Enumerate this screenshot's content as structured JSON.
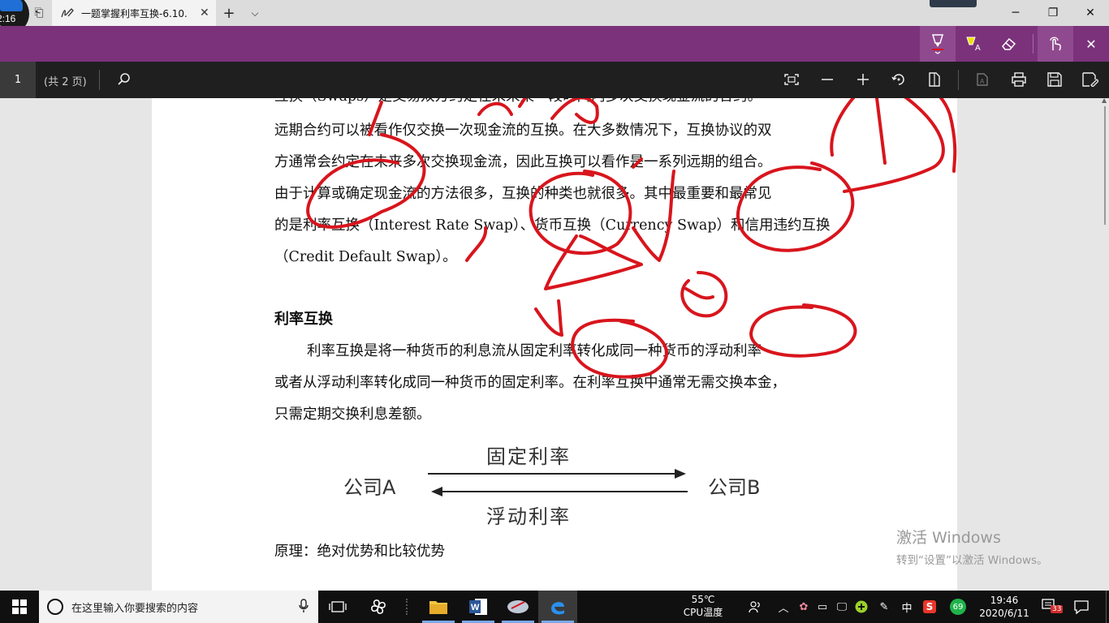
{
  "window": {
    "clock_badge": "2:16",
    "tab_title": "一题掌握利率互换-6.10.",
    "tab_close": "✕",
    "new_tab": "+",
    "tab_list": "⌵",
    "minimize": "─",
    "restore": "❐",
    "close": "✕"
  },
  "pdf_toolbar": {
    "page_number": "1",
    "page_total": "(共 2 页)"
  },
  "document": {
    "lines": [
      "互换（Swaps）是交易双方约定在未来某一段时间内多次交换现金流的合约。",
      "远期合约可以被看作仅交换一次现金流的互换。在大多数情况下，互换协议的双",
      "方通常会约定在未来多次交换现金流，因此互换可以看作是一系列远期的组合。",
      "由于计算或确定现金流的方法很多，互换的种类也就很多。其中最重要和最常见",
      "的是利率互换（Interest Rate Swap）、货币互换（Currency Swap）和信用违约互换",
      "（Credit Default Swap）。"
    ],
    "section_heading": "利率互换",
    "section_lines": [
      "利率互换是将一种货币的利息流从固定利率转化成同一种货币的浮动利率",
      "或者从浮动利率转化成同一种货币的固定利率。在利率互换中通常无需交换本金，",
      "只需定期交换利息差额。"
    ],
    "diagram": {
      "top_label": "固定利率",
      "bottom_label": "浮动利率",
      "left_party": "公司A",
      "right_party": "公司B"
    },
    "principle": "原理：绝对优势和比较优势"
  },
  "watermark": {
    "line1": "激活 Windows",
    "line2": "转到“设置”以激活 Windows。"
  },
  "taskbar": {
    "search_placeholder": "在这里输入你要搜索的内容",
    "temperature": "55℃",
    "temperature_label": "CPU温度",
    "ime": "中",
    "sogou": "S",
    "green_badge": "69",
    "time": "19:46",
    "date": "2020/6/11",
    "notification_count": "33"
  },
  "colors": {
    "ink_toolbar": "#7b327b",
    "pdf_toolbar": "#1f1f1f",
    "ink_stroke": "#d8151d",
    "taskbar": "#101010"
  }
}
